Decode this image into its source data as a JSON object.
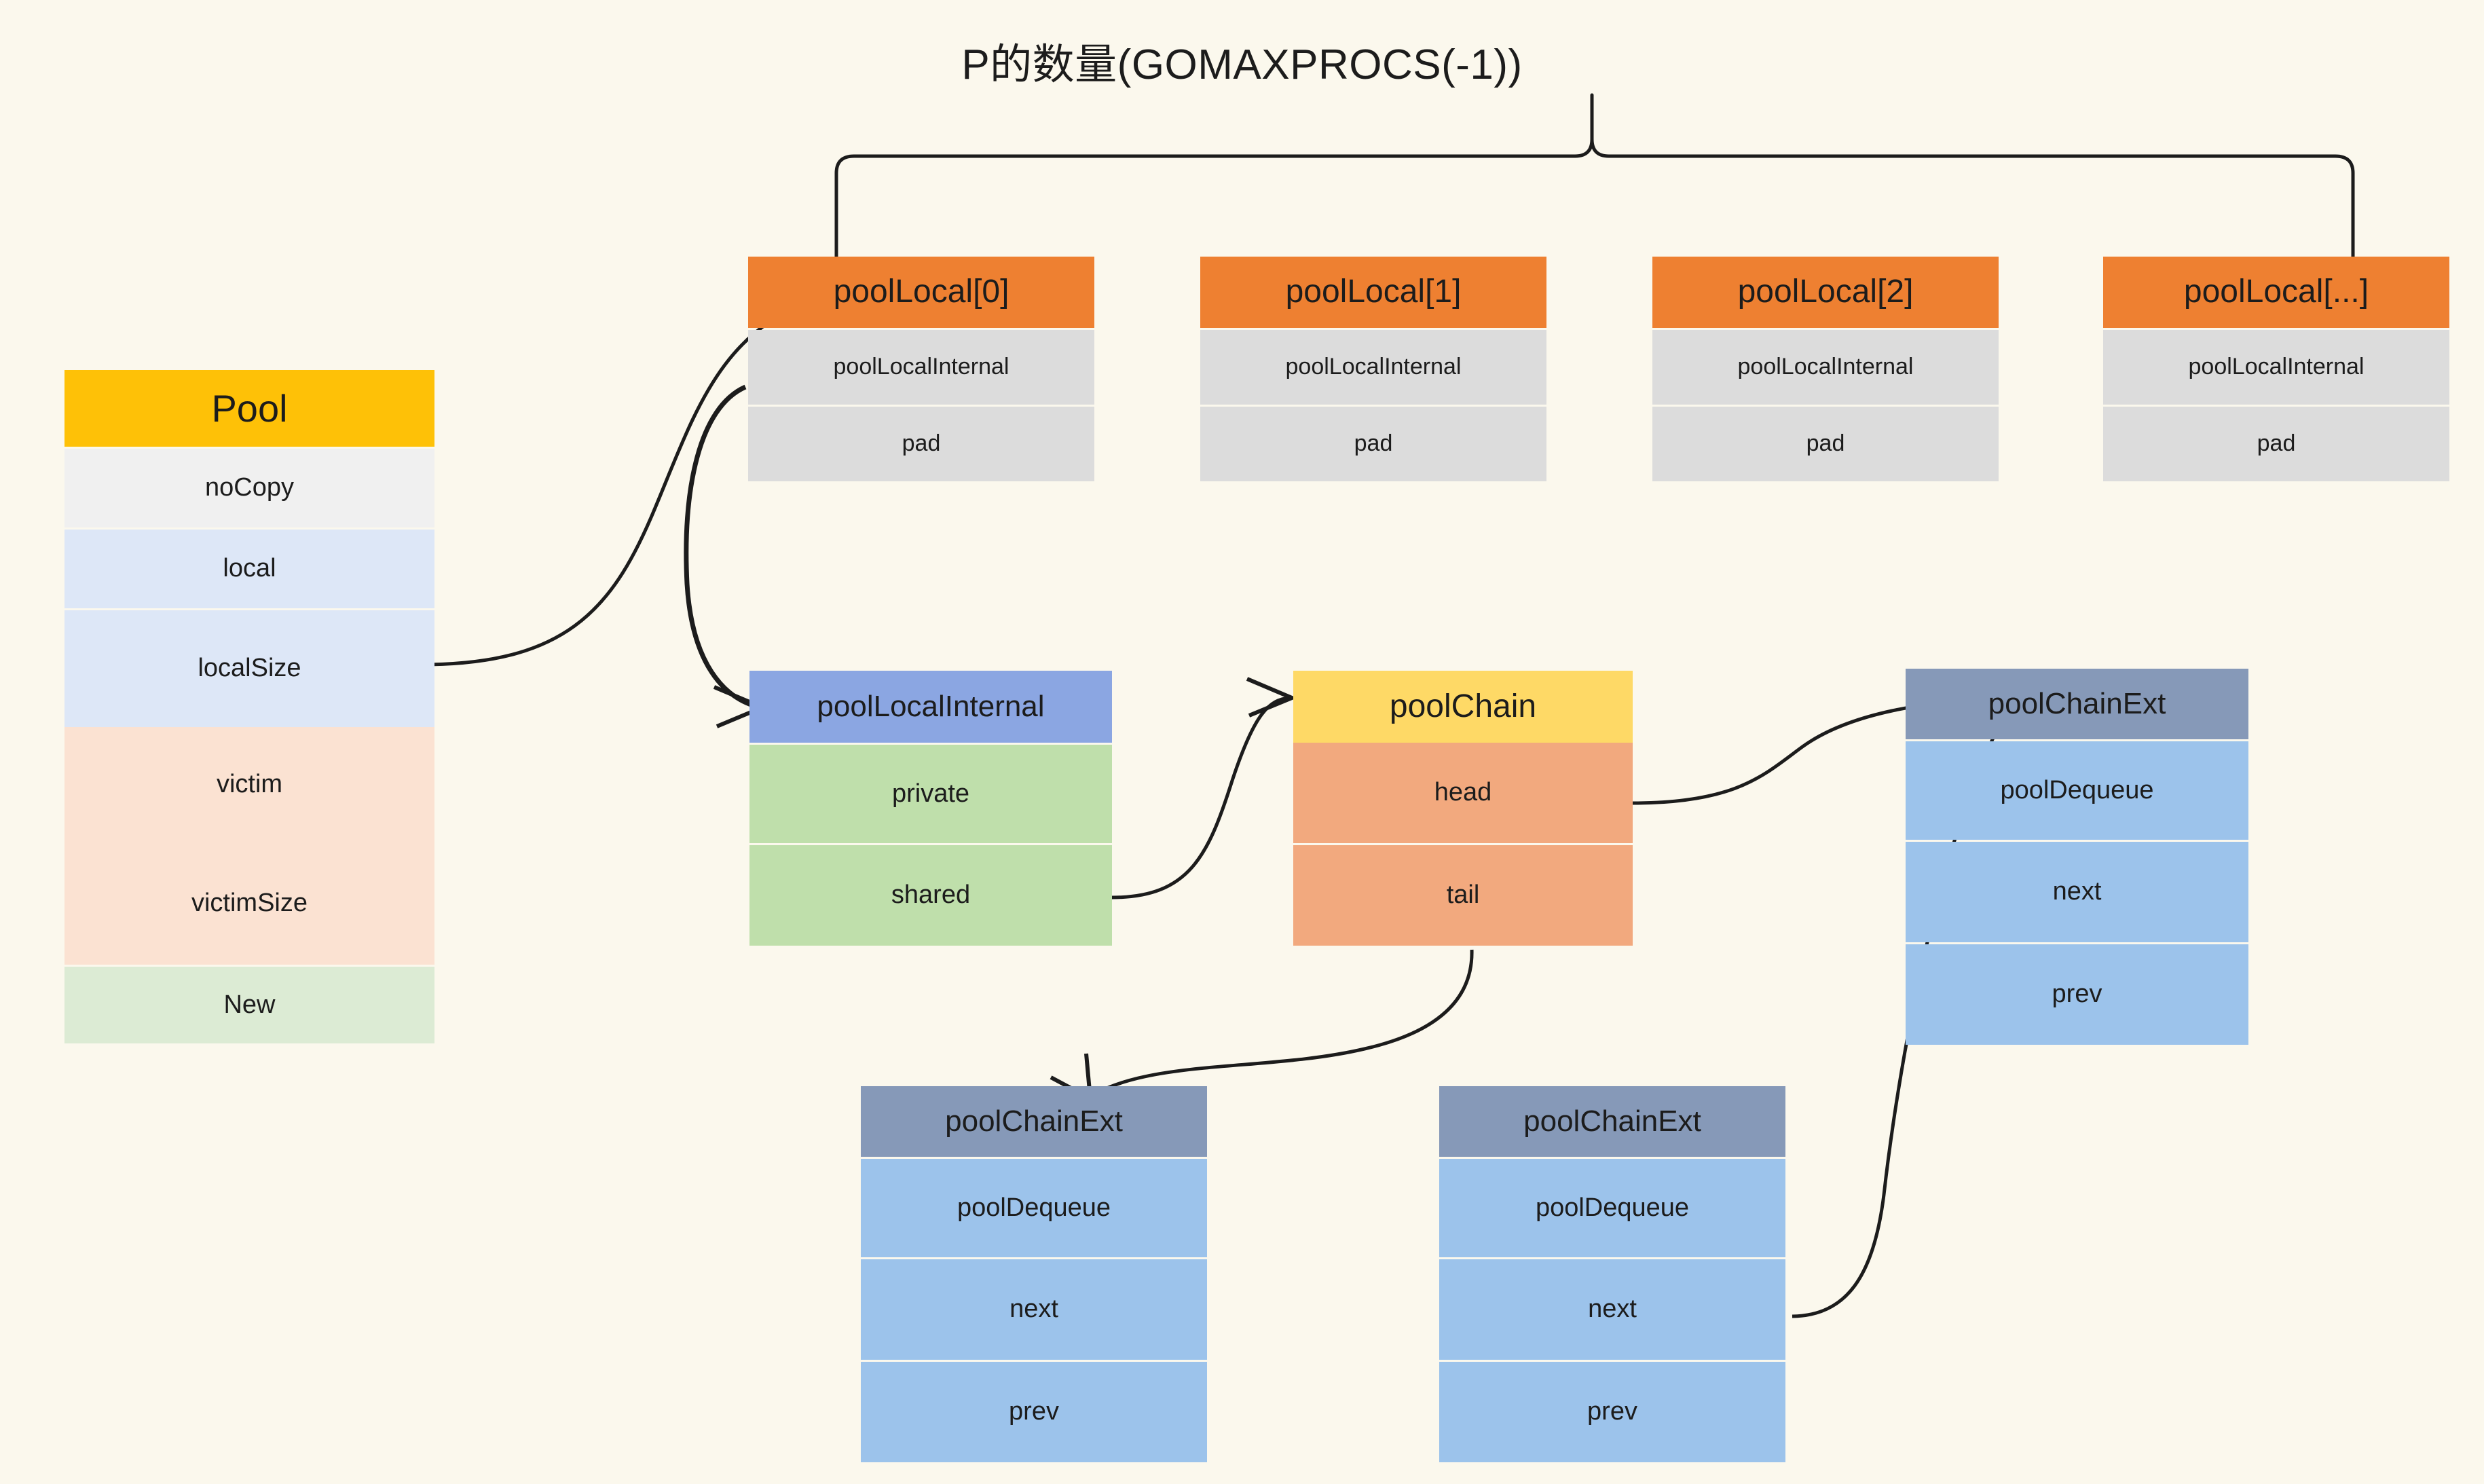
{
  "title": "P的数量(GOMAXPROCS(-1))",
  "colors": {
    "background": "#fbf8ed",
    "pool_header": "#fec107",
    "pool_nocopy": "#f0f0f0",
    "pool_local": "#dde7f7",
    "pool_victim": "#fbe2d2",
    "pool_new": "#dcebd4",
    "poollocal_header": "#ee8031",
    "poollocal_field": "#dcdcdc",
    "poollocalinternal_header": "#8ba6e2",
    "poollocalinternal_field": "#bfdfab",
    "poolchain_header": "#fed966",
    "poolchain_field": "#f2a97e",
    "poolchainext_header": "#8699b8",
    "poolchainext_field": "#9cc3eb",
    "connector": "#1c1c1c"
  },
  "pool": {
    "header": "Pool",
    "fields": [
      "noCopy",
      "local",
      "localSize",
      "victim",
      "victimSize",
      "New"
    ]
  },
  "pool_locals": [
    {
      "header": "poolLocal[0]",
      "fields": [
        "poolLocalInternal",
        "pad"
      ]
    },
    {
      "header": "poolLocal[1]",
      "fields": [
        "poolLocalInternal",
        "pad"
      ]
    },
    {
      "header": "poolLocal[2]",
      "fields": [
        "poolLocalInternal",
        "pad"
      ]
    },
    {
      "header": "poolLocal[...]",
      "fields": [
        "poolLocalInternal",
        "pad"
      ]
    }
  ],
  "pool_local_internal": {
    "header": "poolLocalInternal",
    "fields": [
      "private",
      "shared"
    ]
  },
  "pool_chain": {
    "header": "poolChain",
    "fields": [
      "head",
      "tail"
    ]
  },
  "pool_chain_ext_right": {
    "header": "poolChainExt",
    "fields": [
      "poolDequeue",
      "next",
      "prev"
    ]
  },
  "pool_chain_ext_bottom_left": {
    "header": "poolChainExt",
    "fields": [
      "poolDequeue",
      "next",
      "prev"
    ]
  },
  "pool_chain_ext_bottom_mid": {
    "header": "poolChainExt",
    "fields": [
      "poolDequeue",
      "next",
      "prev"
    ]
  }
}
